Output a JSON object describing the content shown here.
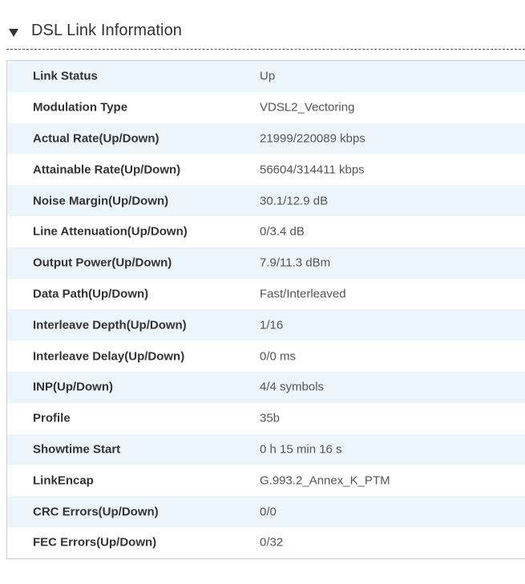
{
  "section": {
    "title": "DSL Link Information",
    "toggle_icon": "triangle-down-icon"
  },
  "rows": [
    {
      "label": "Link Status",
      "value": "Up"
    },
    {
      "label": "Modulation Type",
      "value": "VDSL2_Vectoring"
    },
    {
      "label": "Actual Rate(Up/Down)",
      "value": "21999/220089 kbps"
    },
    {
      "label": "Attainable Rate(Up/Down)",
      "value": "56604/314411 kbps"
    },
    {
      "label": "Noise Margin(Up/Down)",
      "value": "30.1/12.9 dB"
    },
    {
      "label": "Line Attenuation(Up/Down)",
      "value": "0/3.4 dB"
    },
    {
      "label": "Output Power(Up/Down)",
      "value": "7.9/11.3 dBm"
    },
    {
      "label": "Data Path(Up/Down)",
      "value": "Fast/Interleaved"
    },
    {
      "label": "Interleave Depth(Up/Down)",
      "value": "1/16"
    },
    {
      "label": "Interleave Delay(Up/Down)",
      "value": "0/0 ms"
    },
    {
      "label": "INP(Up/Down)",
      "value": "4/4 symbols"
    },
    {
      "label": "Profile",
      "value": "35b"
    },
    {
      "label": "Showtime Start",
      "value": "0 h 15 min 16 s"
    },
    {
      "label": "LinkEncap",
      "value": "G.993.2_Annex_K_PTM"
    },
    {
      "label": "CRC Errors(Up/Down)",
      "value": "0/0"
    },
    {
      "label": "FEC Errors(Up/Down)",
      "value": "0/32"
    }
  ],
  "colors": {
    "row_alt_background": "#edf5fc",
    "row_background": "#ffffff",
    "label_text": "#333333",
    "value_text": "#555555"
  }
}
